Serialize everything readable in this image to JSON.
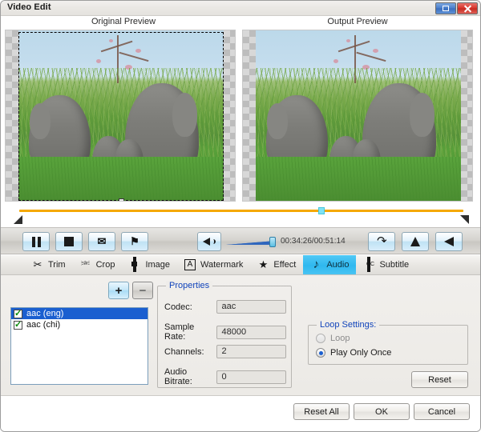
{
  "window": {
    "title": "Video Edit",
    "controls": [
      {
        "name": "maximize-button",
        "icon": "maximize-icon",
        "color": "#4a7fcc"
      },
      {
        "name": "close-button",
        "icon": "close-icon",
        "color": "#d8352b"
      }
    ]
  },
  "previews": {
    "original_label": "Original Preview",
    "output_label": "Output Preview"
  },
  "transport": {
    "pause_icon": "pause-icon",
    "stop_icon": "stop-icon",
    "mark_in_icon": "mark-in-icon",
    "mark_in_glyph": "✉",
    "mark_out_icon": "mark-out-icon",
    "mark_out_glyph": "⚑",
    "volume_icon": "speaker-icon",
    "time_display": "00:34:26/00:51:14",
    "undo_icon": "undo-icon",
    "undo_glyph": "↶",
    "flip_vertical_icon": "flip-vertical-icon",
    "flip_horizontal_icon": "flip-horizontal-icon"
  },
  "tabs": [
    {
      "label": "Trim",
      "icon": "scissors-icon",
      "glyph": "✂",
      "active": false
    },
    {
      "label": "Crop",
      "icon": "crop-icon",
      "glyph": "⎃",
      "active": false
    },
    {
      "label": "Image",
      "icon": "image-icon",
      "glyph": "",
      "active": false
    },
    {
      "label": "Watermark",
      "icon": "watermark-icon",
      "glyph": "A",
      "active": false
    },
    {
      "label": "Effect",
      "icon": "star-icon",
      "glyph": "★",
      "active": false
    },
    {
      "label": "Audio",
      "icon": "music-note-icon",
      "glyph": "♪",
      "active": true
    },
    {
      "label": "Subtitle",
      "icon": "subtitle-icon",
      "glyph": "",
      "active": false
    }
  ],
  "audio_panel": {
    "tracks": [
      {
        "label": "aac (eng)",
        "checked": true,
        "selected": true
      },
      {
        "label": "aac (chi)",
        "checked": true,
        "selected": false
      }
    ],
    "add_button": {
      "label": "+",
      "name": "add-audio-button",
      "enabled": true
    },
    "remove_button": {
      "label": "−",
      "name": "remove-audio-button",
      "enabled": false
    },
    "properties": {
      "title": "Properties",
      "fields": [
        {
          "label": "Codec:",
          "value": "aac"
        },
        {
          "label": "Sample Rate:",
          "value": "48000"
        },
        {
          "label": "Channels:",
          "value": "2"
        },
        {
          "label": "Audio Bitrate:",
          "value": "0"
        }
      ]
    },
    "loop_settings": {
      "title": "Loop Settings:",
      "options": [
        {
          "label": "Loop",
          "selected": false,
          "disabled": true
        },
        {
          "label": "Play Only Once",
          "selected": true,
          "disabled": false
        }
      ]
    },
    "reset_label": "Reset"
  },
  "footer": {
    "reset_all_label": "Reset All",
    "ok_label": "OK",
    "cancel_label": "Cancel"
  },
  "colors": {
    "accent_tab": "#2fb8ef",
    "selection": "#1a5fd0",
    "seekbar": "#f5a800",
    "playhead": "#7fe3f5",
    "group_title": "#1144bb"
  }
}
